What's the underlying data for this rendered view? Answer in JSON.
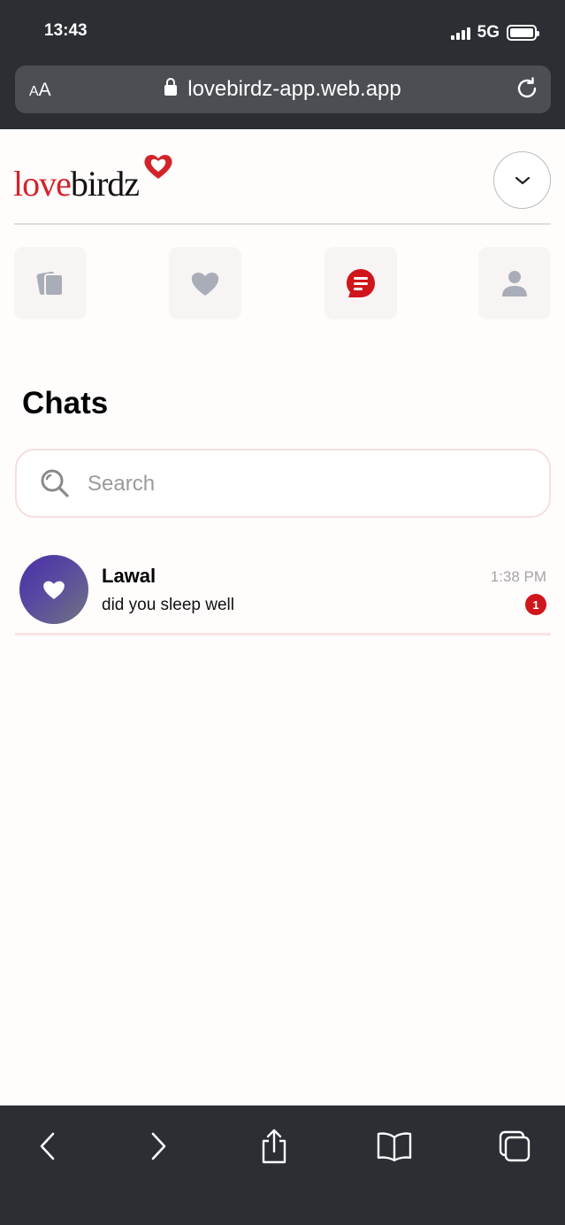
{
  "status_bar": {
    "time": "13:43",
    "network": "5G"
  },
  "browser": {
    "text_size_label_small": "A",
    "text_size_label_large": "A",
    "url": "lovebirdz-app.web.app"
  },
  "logo": {
    "part1": "love",
    "part2": "birdz"
  },
  "nav": {
    "items": [
      {
        "icon": "cards-icon",
        "active": false
      },
      {
        "icon": "heart-icon",
        "active": false
      },
      {
        "icon": "chat-icon",
        "active": true
      },
      {
        "icon": "person-icon",
        "active": false
      }
    ],
    "active_color": "#d0161d",
    "inactive_color": "#a9adb8"
  },
  "page": {
    "title": "Chats"
  },
  "search": {
    "placeholder": "Search",
    "value": ""
  },
  "chats": [
    {
      "name": "Lawal",
      "last_message": "did you sleep well",
      "time": "1:38 PM",
      "unread": "1"
    }
  ]
}
